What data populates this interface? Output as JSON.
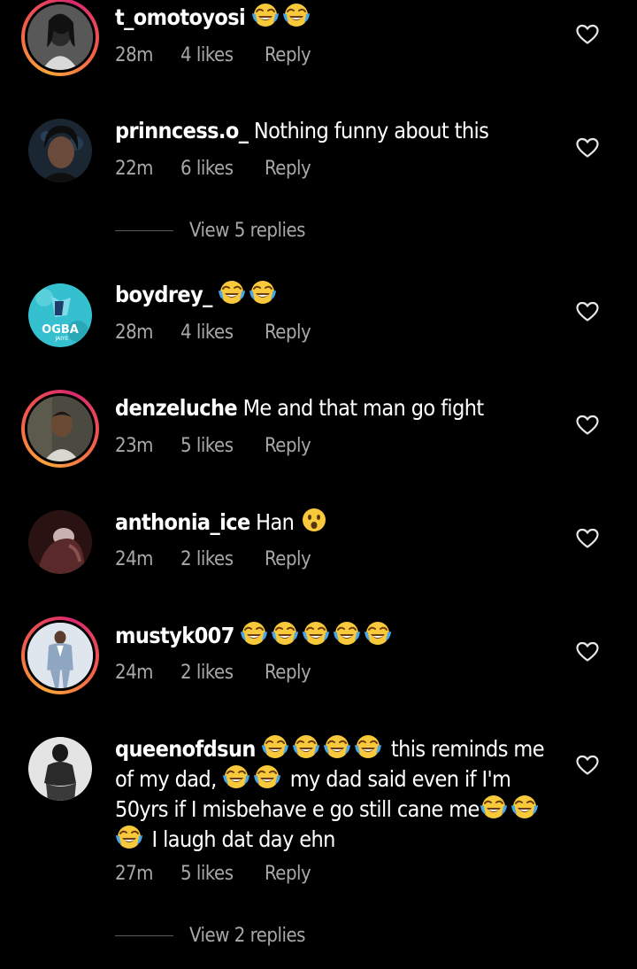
{
  "comments": [
    {
      "username": "t_omotoyosi",
      "text": "",
      "emojis": [
        "laughing-tears",
        "laughing-tears"
      ],
      "time": "28m",
      "likes": "4 likes",
      "reply": "Reply"
    },
    {
      "username": "prinncess.o_",
      "text": " Nothing funny about this",
      "time": "22m",
      "likes": "6 likes",
      "reply": "Reply",
      "view_replies": "View 5 replies"
    },
    {
      "username": "boydrey_",
      "text": "",
      "avatar_text_1": "OGBA",
      "avatar_text_2": "JAIYE",
      "time": "28m",
      "likes": "4 likes",
      "reply": "Reply"
    },
    {
      "username": "denzeluche",
      "text": " Me and that man go fight",
      "time": "23m",
      "likes": "5 likes",
      "reply": "Reply"
    },
    {
      "username": "anthonia_ice",
      "text": " Han ",
      "time": "24m",
      "likes": "2 likes",
      "reply": "Reply"
    },
    {
      "username": "mustyk007",
      "text": "",
      "time": "24m",
      "likes": "2 likes",
      "reply": "Reply"
    },
    {
      "username": "queenofdsun",
      "text_1": " this reminds me of my dad, ",
      "text_2": " my dad said even if I'm 50yrs if I misbehave e go still cane me",
      "text_3": " I laugh dat day ehn",
      "time": "27m",
      "likes": "5 likes",
      "reply": "Reply",
      "view_replies": "View 2 replies"
    }
  ],
  "colors": {
    "background": "#000000",
    "text": "#ffffff",
    "muted": "#a8a8a8",
    "story_ring_start": "#f9a53a",
    "story_ring_end": "#d8296f"
  },
  "icons": {
    "like": "heart-outline-icon",
    "laugh": "face-with-tears-of-joy-emoji",
    "surprise": "face-with-open-mouth-emoji"
  }
}
